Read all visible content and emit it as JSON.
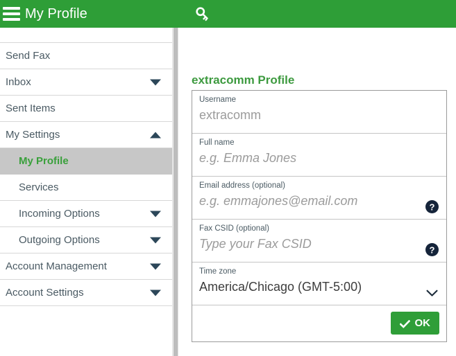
{
  "header": {
    "title": "My Profile",
    "menu_icon": "hamburger-icon",
    "key_icon": "key-icon"
  },
  "sidebar": {
    "items": [
      {
        "label": "",
        "level": "top",
        "caret": "none",
        "active": false,
        "partial": true
      },
      {
        "label": "Send Fax",
        "level": "top",
        "caret": "none",
        "active": false
      },
      {
        "label": "Inbox",
        "level": "top",
        "caret": "down",
        "active": false
      },
      {
        "label": "Sent Items",
        "level": "top",
        "caret": "none",
        "active": false
      },
      {
        "label": "My Settings",
        "level": "top",
        "caret": "up",
        "active": false
      },
      {
        "label": "My Profile",
        "level": "sub",
        "caret": "none",
        "active": true
      },
      {
        "label": "Services",
        "level": "sub",
        "caret": "none",
        "active": false
      },
      {
        "label": "Incoming Options",
        "level": "sub",
        "caret": "down",
        "active": false
      },
      {
        "label": "Outgoing Options",
        "level": "sub",
        "caret": "down",
        "active": false
      },
      {
        "label": "Account Management",
        "level": "top",
        "caret": "down",
        "active": false
      },
      {
        "label": "Account Settings",
        "level": "top",
        "caret": "down",
        "active": false
      }
    ]
  },
  "main": {
    "panel_title": "extracomm Profile",
    "fields": [
      {
        "label": "Username",
        "value": "extracomm",
        "placeholder": "",
        "state": "readonly",
        "help": false,
        "dropdown": false
      },
      {
        "label": "Full name",
        "value": "",
        "placeholder": "e.g. Emma Jones",
        "state": "empty",
        "help": false,
        "dropdown": false
      },
      {
        "label": "Email address (optional)",
        "value": "",
        "placeholder": "e.g. emmajones@email.com",
        "state": "empty",
        "help": true,
        "dropdown": false
      },
      {
        "label": "Fax CSID (optional)",
        "value": "",
        "placeholder": "Type your Fax CSID",
        "state": "empty",
        "help": true,
        "dropdown": false
      },
      {
        "label": "Time zone",
        "value": "America/Chicago (GMT-5:00)",
        "placeholder": "",
        "state": "filled",
        "help": false,
        "dropdown": true
      }
    ],
    "ok_button": {
      "label": "OK",
      "icon": "check-icon"
    }
  },
  "colors": {
    "brand_green": "#2e9e37",
    "title_green": "#3d9a3f",
    "sidebar_text": "#4a5a63",
    "active_bg": "#c7c7c7",
    "caret": "#2c4759",
    "help_circle": "#15243a"
  }
}
